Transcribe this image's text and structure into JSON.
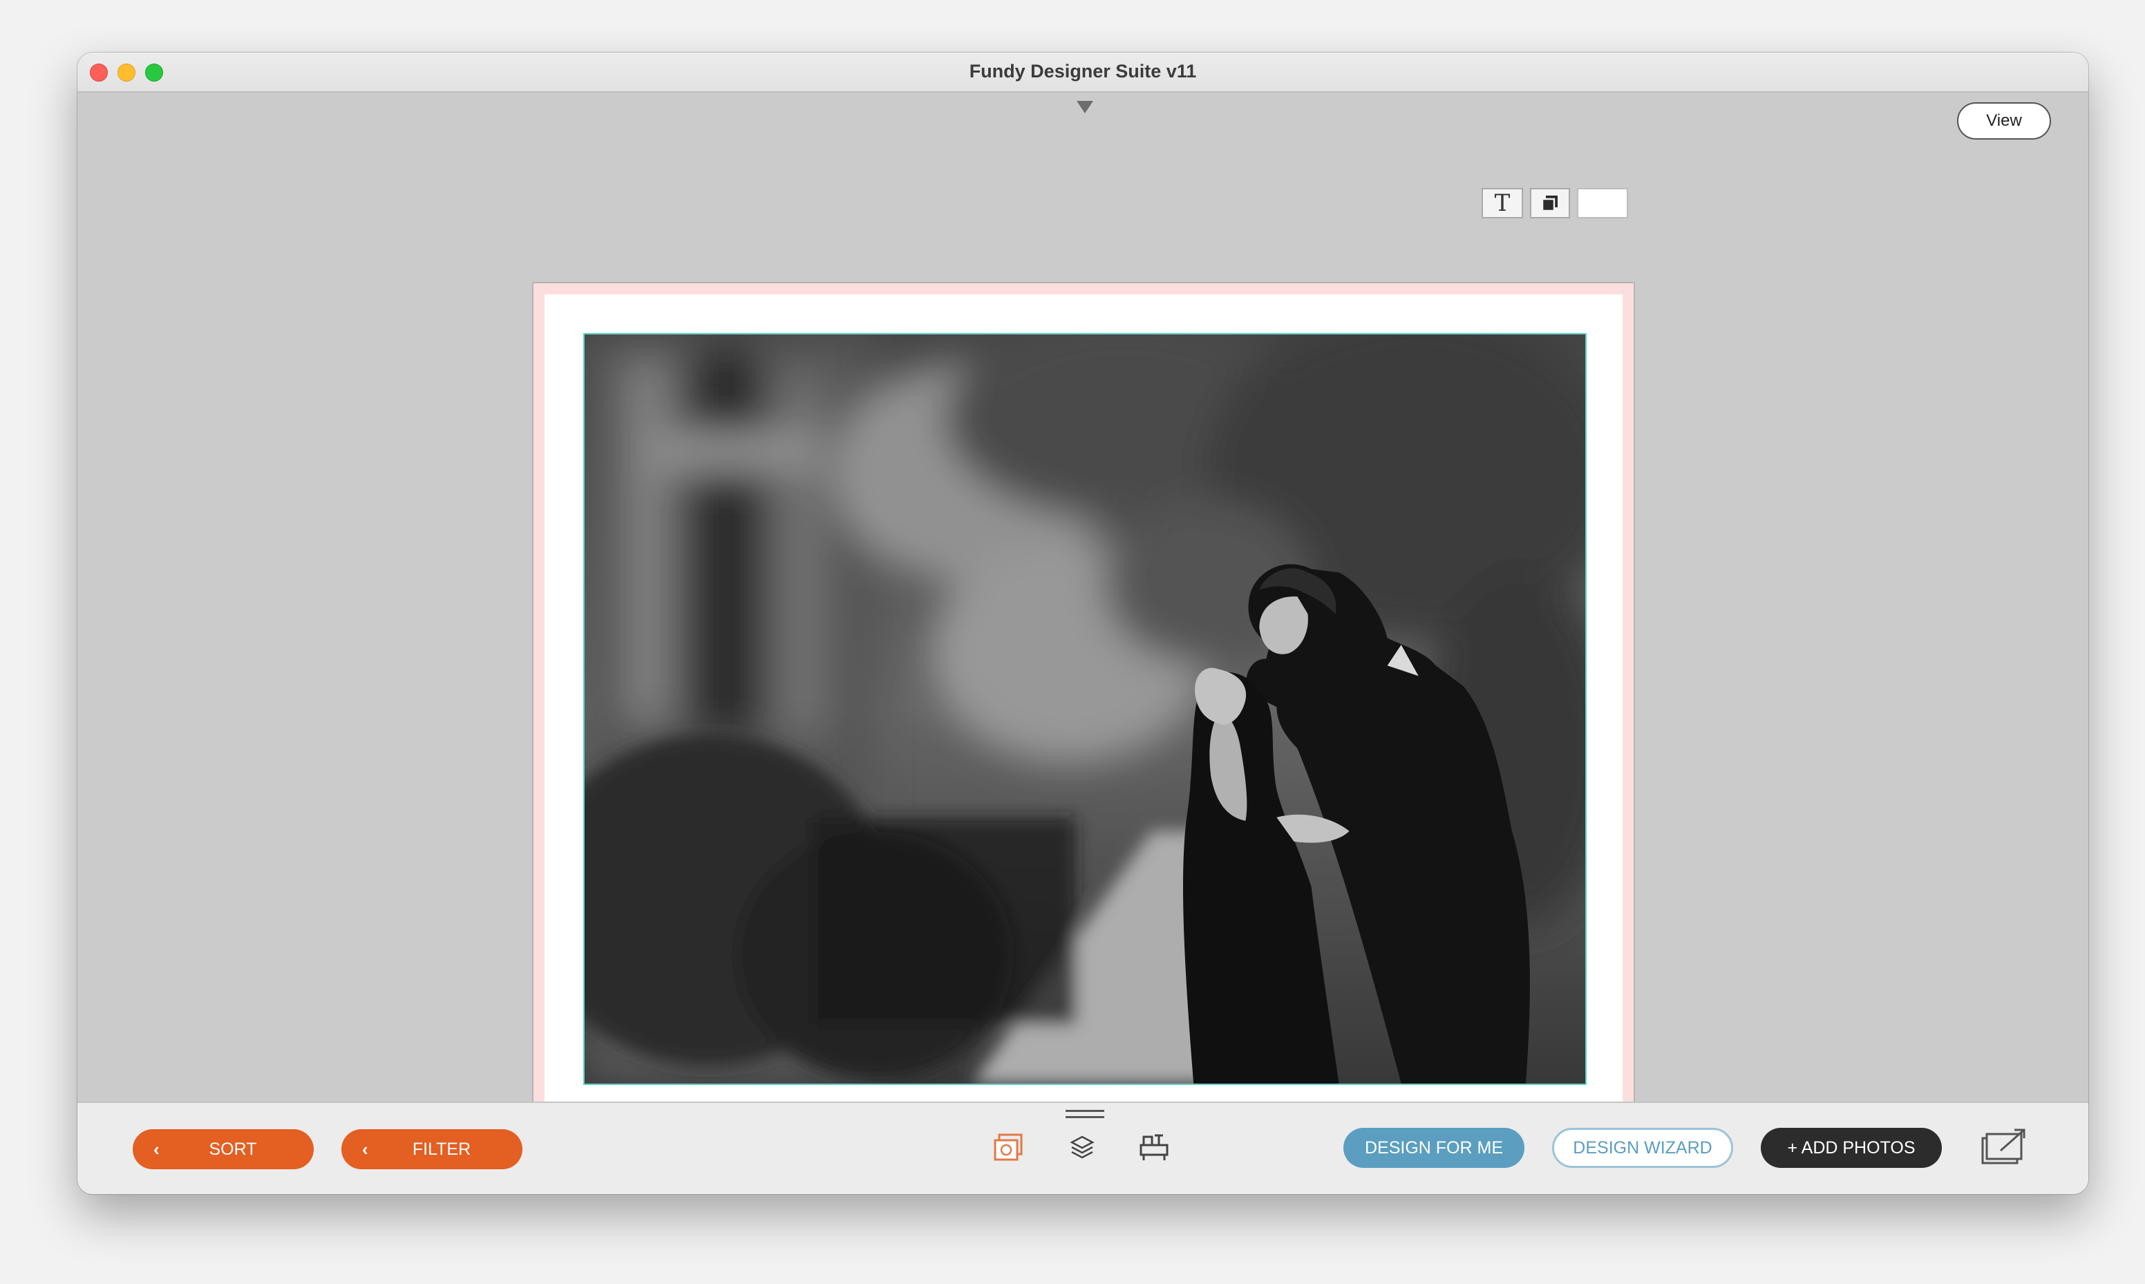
{
  "window": {
    "title": "Fundy Designer Suite v11"
  },
  "header": {
    "view_label": "View"
  },
  "toolbar": {
    "text_tool": "T"
  },
  "bottom": {
    "sort_label": "SORT",
    "filter_label": "FILTER",
    "design_for_me_label": "DESIGN FOR ME",
    "design_wizard_label": "DESIGN WIZARD",
    "add_photos_label": "+ ADD PHOTOS"
  },
  "colors": {
    "accent_orange": "#e35f22",
    "accent_blue": "#5b9ec0",
    "dark_button": "#2c2c2c",
    "selection_outline": "#58d4c4",
    "spread_bleed": "#fcdede"
  },
  "icons": {
    "gallery": "gallery-icon",
    "layers": "layers-icon",
    "panel": "panel-icon",
    "export": "export-icon"
  }
}
